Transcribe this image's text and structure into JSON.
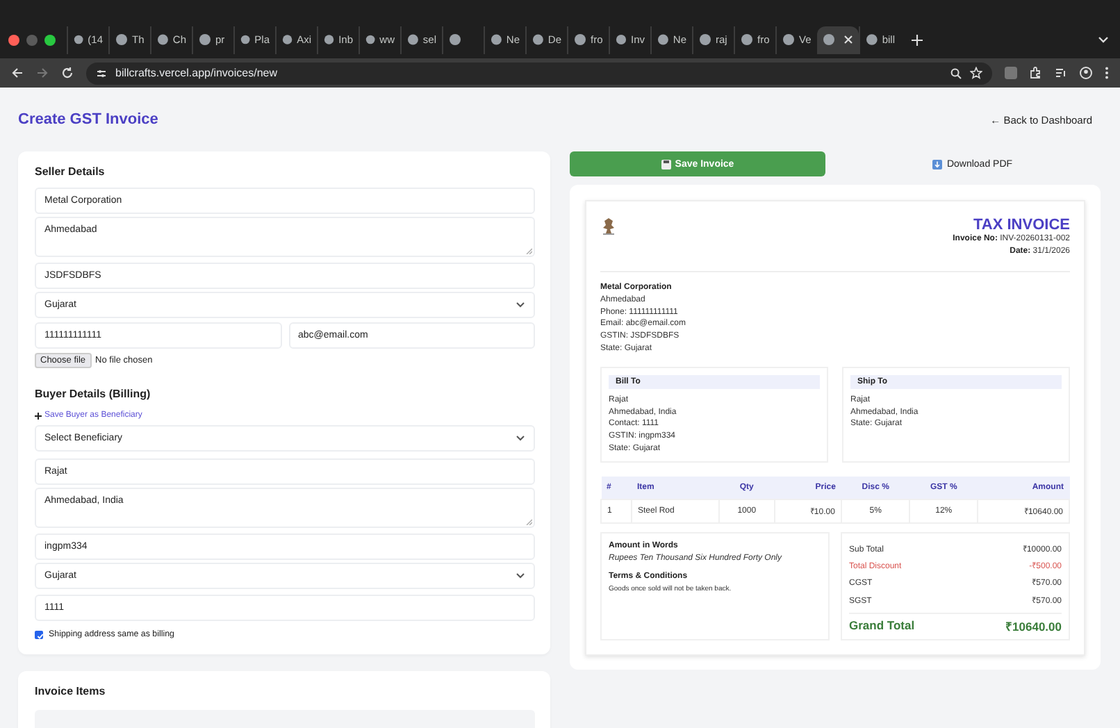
{
  "browser": {
    "tabs": [
      {
        "label": "(14",
        "selected": false
      },
      {
        "label": "Th",
        "selected": false
      },
      {
        "label": "Ch",
        "selected": false
      },
      {
        "label": "pr",
        "selected": false
      },
      {
        "label": "Pla",
        "selected": false
      },
      {
        "label": "Axi",
        "selected": false
      },
      {
        "label": "Inb",
        "selected": false
      },
      {
        "label": "ww",
        "selected": false
      },
      {
        "label": "sel",
        "selected": false
      },
      {
        "selected": false
      },
      {
        "label": "Ne",
        "selected": false
      },
      {
        "label": "De",
        "selected": false
      },
      {
        "label": "fro",
        "selected": false
      },
      {
        "label": "Inv",
        "selected": false
      },
      {
        "label": "Ne",
        "selected": false
      },
      {
        "label": "raj",
        "selected": false
      },
      {
        "label": "fro",
        "selected": false
      },
      {
        "label": "Ve",
        "selected": false
      },
      {
        "selected": true
      },
      {
        "label": "bill",
        "selected": false
      }
    ],
    "url": "billcrafts.vercel.app/invoices/new"
  },
  "page": {
    "title": "Create GST Invoice",
    "back_link": "← Back to Dashboard"
  },
  "seller": {
    "heading": "Seller Details",
    "name": "Metal Corporation",
    "address": "Ahmedabad",
    "gstin": "JSDFSDBFS",
    "state": "Gujarat",
    "phone": "111111111111",
    "email": "abc@email.com",
    "file_button": "Choose file",
    "file_status": "No file chosen"
  },
  "buyer": {
    "heading": "Buyer Details (Billing)",
    "save_link": "Save Buyer as Beneficiary",
    "beneficiary": "Select Beneficiary",
    "name": "Rajat",
    "address": "Ahmedabad, India",
    "gstin": "ingpm334",
    "state": "Gujarat",
    "contact": "1111",
    "same_shipping": {
      "label": "Shipping address same as billing",
      "checked": true
    }
  },
  "items_card": {
    "heading": "Invoice Items"
  },
  "actions": [
    {
      "label": "Save Invoice",
      "kind": "primary"
    },
    {
      "label": "Download PDF",
      "kind": "secondary"
    }
  ],
  "preview": {
    "title": "TAX INVOICE",
    "invoice_no_label": "Invoice No:",
    "invoice_no": "INV-20260131-002",
    "date_label": "Date:",
    "date": "31/1/2026",
    "seller_lines": [
      "Metal Corporation",
      "Ahmedabad",
      "Phone: 111111111111",
      "Email: abc@email.com",
      "GSTIN: JSDFSDBFS",
      "State: Gujarat"
    ],
    "bill_to": {
      "heading": "Bill To",
      "lines": [
        "Rajat",
        "Ahmedabad, India",
        "Contact: 1111",
        "GSTIN: ingpm334",
        "State: Gujarat"
      ]
    },
    "ship_to": {
      "heading": "Ship To",
      "lines": [
        "Rajat",
        "Ahmedabad, India",
        "State: Gujarat"
      ]
    },
    "columns": [
      "#",
      "Item",
      "Qty",
      "Price",
      "Disc %",
      "GST %",
      "Amount"
    ],
    "rows": [
      [
        "1",
        "Steel Rod",
        "1000",
        "₹10.00",
        "5%",
        "12%",
        "₹10640.00"
      ]
    ],
    "words_heading": "Amount in Words",
    "words": "Rupees Ten Thousand Six Hundred Forty Only",
    "terms_heading": "Terms & Conditions",
    "terms": "Goods once sold will not be taken back.",
    "totals": [
      {
        "label": "Sub Total",
        "value": "₹10000.00",
        "kind": "normal"
      },
      {
        "label": "Total Discount",
        "value": "-₹500.00",
        "kind": "discount"
      },
      {
        "label": "CGST",
        "value": "₹570.00",
        "kind": "normal"
      },
      {
        "label": "SGST",
        "value": "₹570.00",
        "kind": "normal"
      }
    ],
    "grand_total": {
      "label": "Grand Total",
      "value": "₹10640.00"
    }
  }
}
